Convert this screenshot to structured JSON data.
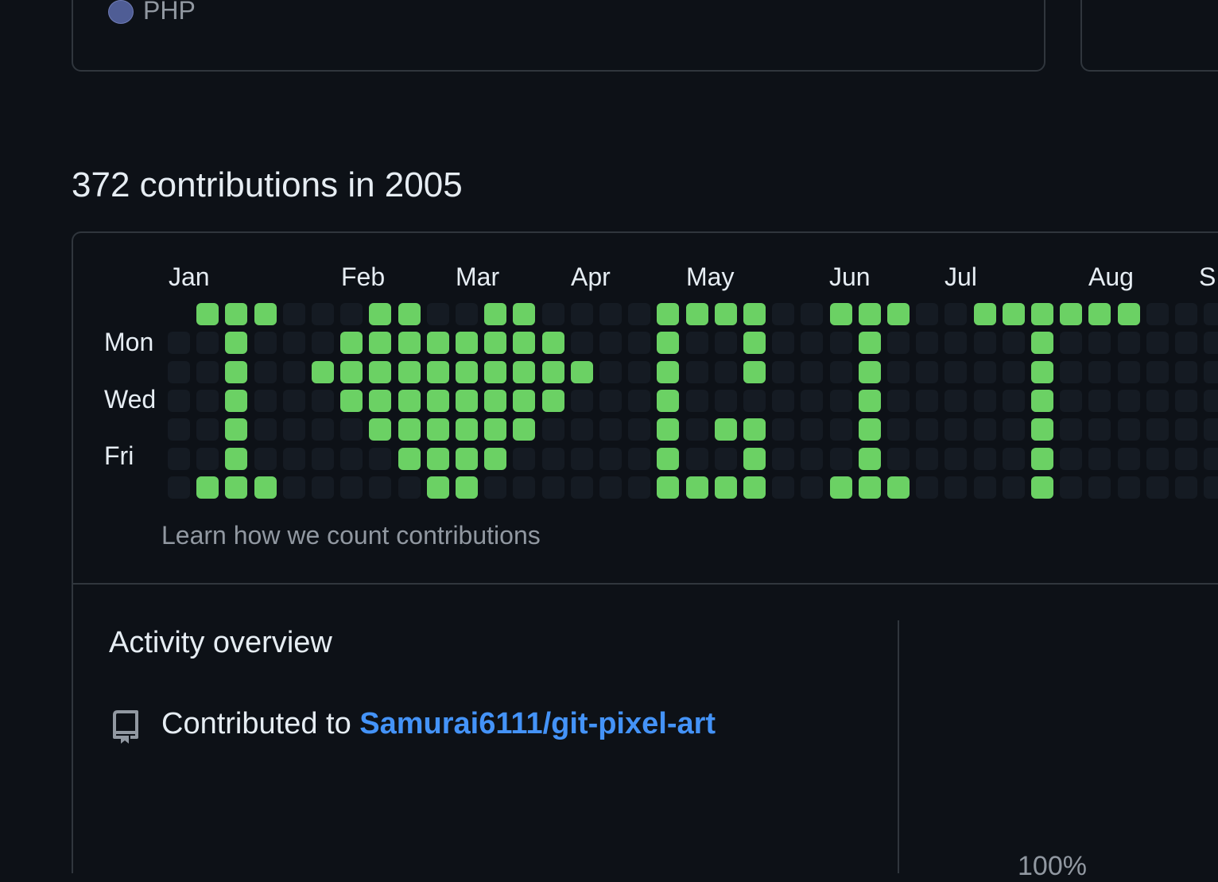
{
  "languages": {
    "items": [
      {
        "name": "PHP",
        "color": "#4F5D95"
      }
    ]
  },
  "contributions": {
    "title": "372 contributions in 2005",
    "months": [
      "Jan",
      "Feb",
      "Mar",
      "Apr",
      "May",
      "Jun",
      "Jul",
      "Aug",
      "S"
    ],
    "days": [
      "Mon",
      "Wed",
      "Fri"
    ],
    "learn_link": "Learn how we count contributions",
    "colors": {
      "empty": "#151b23",
      "active": "#6bd164"
    },
    "grid_rows": [
      "-1110001100110000111100111001111110000",
      "0010001111111100010010001000001000000",
      "0010011111111110010010001000001000000",
      "0010001111111100010000001000001000000",
      "0010000111111000010110001000001000000",
      "0010000011110000010010001000001000000",
      "0111000001100000011110011100001000000"
    ]
  },
  "activity": {
    "title": "Activity overview",
    "contributed_prefix": "Contributed to",
    "repo": "Samurai6111/git-pixel-art",
    "percent": "100%",
    "icon": "repo-icon",
    "link_color": "#4493f8"
  }
}
